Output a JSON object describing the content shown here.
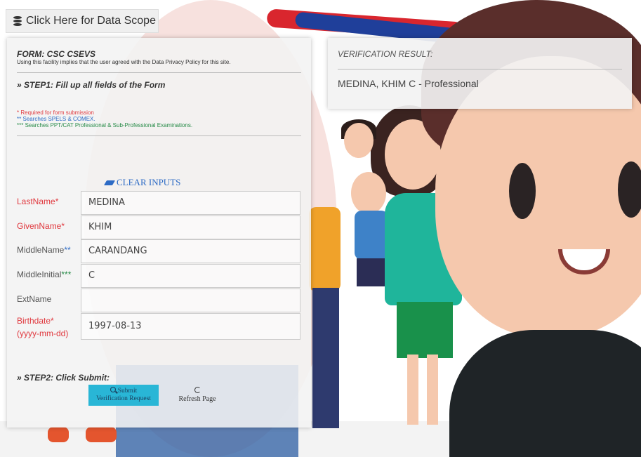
{
  "scope_button": {
    "label": "Click Here for Data Scope",
    "icon": "database-icon"
  },
  "form": {
    "title": "FORM: CSC CSEVS",
    "privacy_note": "Using this facility implies that the user agreed with the Data Privacy Policy for this site.",
    "step1": "» STEP1: Fill up all fields of the Form",
    "notes": {
      "required": "* Required for form submission",
      "spels": "** Searches SPELS & COMEX.",
      "ppt": "*** Searches PPT/CAT Professional & Sub-Professional Examinations."
    },
    "clear_inputs": "CLEAR INPUTS",
    "fields": {
      "lastname": {
        "label": "LastName",
        "marker": "*",
        "value": "MEDINA"
      },
      "givenname": {
        "label": "GivenName",
        "marker": "*",
        "value": "KHIM"
      },
      "middlename": {
        "label": "MiddleName",
        "marker": "**",
        "value": "CARANDANG"
      },
      "middleinitial": {
        "label": "MiddleInitial",
        "marker": "***",
        "value": "C"
      },
      "extname": {
        "label": "ExtName",
        "value": ""
      },
      "birthdate": {
        "label": "Birthdate*",
        "label2": "(yyyy-mm-dd)",
        "value": "1997-08-13"
      }
    },
    "step2": "» STEP2: Click Submit:",
    "submit_label_1": "Submit",
    "submit_label_2": "Verification Request",
    "refresh_label": "Refresh Page"
  },
  "result": {
    "title": "VERIFICATION RESULT:",
    "value": "MEDINA, KHIM C - Professional"
  },
  "colors": {
    "required_red": "#e0383e",
    "link_blue": "#2d6bc5",
    "note_green": "#258a46",
    "submit_bg": "#29b6d6"
  }
}
